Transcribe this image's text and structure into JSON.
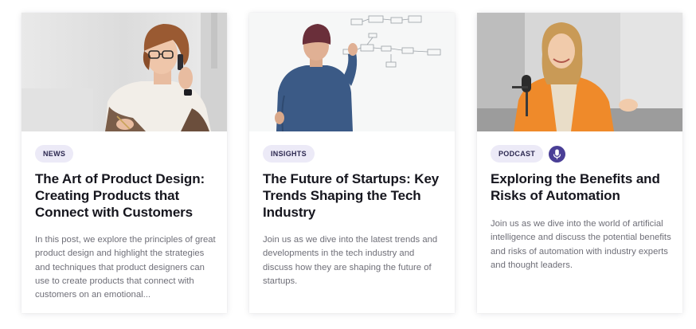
{
  "cards": [
    {
      "category": "NEWS",
      "title": "The Art of Product Design: Creating Products that Connect with Customers",
      "description": "In this post, we explore the principles of great product design and highlight the strategies and techniques that product designers can use to create products that connect with customers on an emotional...",
      "image": "woman-with-glasses-on-phone-photo"
    },
    {
      "category": "INSIGHTS",
      "title": "The Future of Startups: Key Trends Shaping the Tech Industry",
      "description": "Join us as we dive into the latest trends and developments in the tech industry and discuss how they are shaping the future of startups.",
      "image": "man-at-whiteboard-photo"
    },
    {
      "category": "PODCAST",
      "title": "Exploring the Benefits and Risks of Automation",
      "description": "Join us as we dive into the world of artificial intelligence and discuss the potential benefits and risks of automation with industry experts and thought leaders.",
      "image": "woman-podcasting-photo",
      "extra_icon": "microphone-icon"
    }
  ],
  "colors": {
    "badge_bg": "#eceaf7",
    "badge_text": "#2c2850",
    "title": "#16161e",
    "description": "#6f6f78",
    "podcast_icon_bg": "#4a3f96"
  }
}
